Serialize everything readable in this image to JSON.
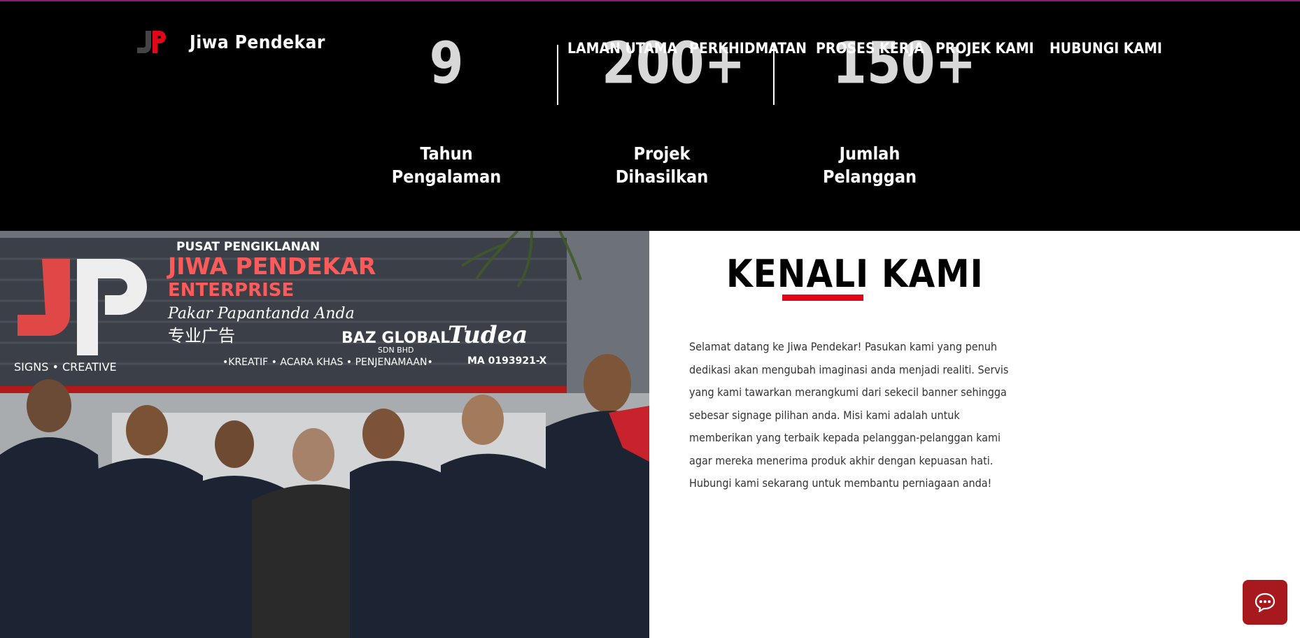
{
  "brand": {
    "name": "Jiwa Pendekar",
    "logo_icon": "jp-logo-icon"
  },
  "nav": {
    "items": [
      {
        "label": "LAMAN UTAMA"
      },
      {
        "label": "PERKHIDMATAN"
      },
      {
        "label": "PROSES KERJA"
      },
      {
        "label": "PROJEK KAMI"
      },
      {
        "label": "HUBUNGI KAMI"
      }
    ]
  },
  "stats": [
    {
      "value": "9",
      "label_line1": "Tahun",
      "label_line2": "Pengalaman"
    },
    {
      "value": "200+",
      "label_line1": "Projek",
      "label_line2": "Dihasilkan"
    },
    {
      "value": "150+",
      "label_line1": "Jumlah",
      "label_line2": "Pelanggan"
    }
  ],
  "photo": {
    "sign_line1": "PUSAT PENGIKLANAN",
    "sign_line2": "JIWA PENDEKAR",
    "sign_line3": "ENTERPRISE",
    "sign_line4": "Pakar Papantanda Anda",
    "sign_chinese": "专业广告",
    "sign_sub": "SIGNS • CREATIVE",
    "sign_services": "•KREATIF • ACARA KHAS • PENJENAMAAN•",
    "sign_baz": "BAZ GLOBAL",
    "sign_baz_sub": "SDN BHD",
    "sign_tudea": "Tudea",
    "sign_reg": "MA 0193921-X"
  },
  "about": {
    "title": "KENALI KAMI",
    "text": "Selamat datang ke Jiwa Pendekar! Pasukan kami yang penuh dedikasi akan mengubah imaginasi anda menjadi realiti. Servis yang kami tawarkan merangkumi dari sekecil banner sehingga sebesar signage pilihan anda. Misi kami adalah untuk memberikan yang terbaik kepada pelanggan-pelanggan kami agar mereka menerima produk akhir dengan kepuasan hati. Hubungi kami sekarang untuk membantu perniagaan anda!"
  },
  "colors": {
    "accent": "#e3061a",
    "chat_button": "#a8191e",
    "top_line": "#8a1a7a"
  },
  "chat": {
    "icon": "chat-bubble-icon"
  }
}
